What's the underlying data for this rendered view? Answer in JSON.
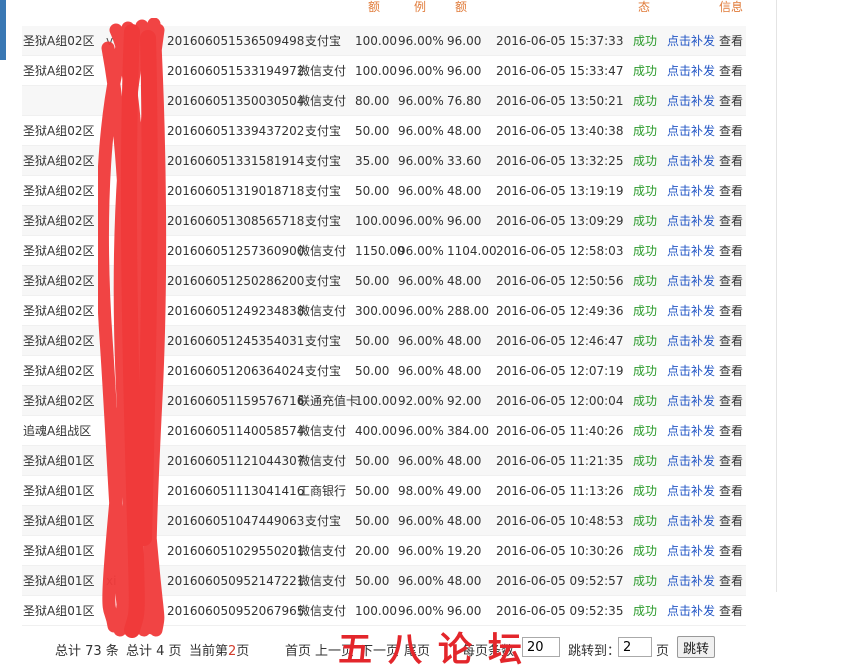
{
  "header": {
    "col_amount": "额",
    "col_rate": "例",
    "col_real": "额",
    "col_state": "态",
    "col_info": "信息"
  },
  "rows": [
    {
      "area": "圣狱A组02区",
      "user": "v",
      "order": "201606051536509498",
      "pay": "支付宝",
      "amount": "100.00",
      "rate": "96.00%",
      "real": "96.00",
      "time": "2016-06-05 15:37:33",
      "state": "成功",
      "resend": "点击补发",
      "view": "查看"
    },
    {
      "area": "圣狱A组02区",
      "user": "",
      "order": "201606051533194972",
      "pay": "微信支付",
      "amount": "100.00",
      "rate": "96.00%",
      "real": "96.00",
      "time": "2016-06-05 15:33:47",
      "state": "成功",
      "resend": "点击补发",
      "view": "查看"
    },
    {
      "area": "",
      "user": "",
      "order": "201606051350030504",
      "pay": "微信支付",
      "amount": "80.00",
      "rate": "96.00%",
      "real": "76.80",
      "time": "2016-06-05 13:50:21",
      "state": "成功",
      "resend": "点击补发",
      "view": "查看"
    },
    {
      "area": "圣狱A组02区",
      "user": "",
      "order": "201606051339437202",
      "pay": "支付宝",
      "amount": "50.00",
      "rate": "96.00%",
      "real": "48.00",
      "time": "2016-06-05 13:40:38",
      "state": "成功",
      "resend": "点击补发",
      "view": "查看"
    },
    {
      "area": "圣狱A组02区",
      "user": "",
      "order": "201606051331581914",
      "pay": "支付宝",
      "amount": "35.00",
      "rate": "96.00%",
      "real": "33.60",
      "time": "2016-06-05 13:32:25",
      "state": "成功",
      "resend": "点击补发",
      "view": "查看"
    },
    {
      "area": "圣狱A组02区",
      "user": "",
      "order": "201606051319018718",
      "pay": "支付宝",
      "amount": "50.00",
      "rate": "96.00%",
      "real": "48.00",
      "time": "2016-06-05 13:19:19",
      "state": "成功",
      "resend": "点击补发",
      "view": "查看"
    },
    {
      "area": "圣狱A组02区",
      "user": "",
      "order": "201606051308565718",
      "pay": "支付宝",
      "amount": "100.00",
      "rate": "96.00%",
      "real": "96.00",
      "time": "2016-06-05 13:09:29",
      "state": "成功",
      "resend": "点击补发",
      "view": "查看"
    },
    {
      "area": "圣狱A组02区",
      "user": "",
      "order": "201606051257360900",
      "pay": "微信支付",
      "amount": "1150.00",
      "rate": "96.00%",
      "real": "1104.00",
      "time": "2016-06-05 12:58:03",
      "state": "成功",
      "resend": "点击补发",
      "view": "查看"
    },
    {
      "area": "圣狱A组02区",
      "user": "",
      "order": "201606051250286200",
      "pay": "支付宝",
      "amount": "50.00",
      "rate": "96.00%",
      "real": "48.00",
      "time": "2016-06-05 12:50:56",
      "state": "成功",
      "resend": "点击补发",
      "view": "查看"
    },
    {
      "area": "圣狱A组02区",
      "user": "",
      "order": "201606051249234838",
      "pay": "微信支付",
      "amount": "300.00",
      "rate": "96.00%",
      "real": "288.00",
      "time": "2016-06-05 12:49:36",
      "state": "成功",
      "resend": "点击补发",
      "view": "查看"
    },
    {
      "area": "圣狱A组02区",
      "user": "",
      "order": "201606051245354031",
      "pay": "支付宝",
      "amount": "50.00",
      "rate": "96.00%",
      "real": "48.00",
      "time": "2016-06-05 12:46:47",
      "state": "成功",
      "resend": "点击补发",
      "view": "查看"
    },
    {
      "area": "圣狱A组02区",
      "user": "",
      "order": "201606051206364024",
      "pay": "支付宝",
      "amount": "50.00",
      "rate": "96.00%",
      "real": "48.00",
      "time": "2016-06-05 12:07:19",
      "state": "成功",
      "resend": "点击补发",
      "view": "查看"
    },
    {
      "area": "圣狱A组02区",
      "user": "",
      "order": "201606051159576716",
      "pay": "联通充值卡",
      "amount": "100.00",
      "rate": "92.00%",
      "real": "92.00",
      "time": "2016-06-05 12:00:04",
      "state": "成功",
      "resend": "点击补发",
      "view": "查看"
    },
    {
      "area": "追魂A组战区",
      "user": "",
      "order": "201606051140058574",
      "pay": "微信支付",
      "amount": "400.00",
      "rate": "96.00%",
      "real": "384.00",
      "time": "2016-06-05 11:40:26",
      "state": "成功",
      "resend": "点击补发",
      "view": "查看"
    },
    {
      "area": "圣狱A组01区",
      "user": "",
      "order": "201606051121044307",
      "pay": "微信支付",
      "amount": "50.00",
      "rate": "96.00%",
      "real": "48.00",
      "time": "2016-06-05 11:21:35",
      "state": "成功",
      "resend": "点击补发",
      "view": "查看"
    },
    {
      "area": "圣狱A组01区",
      "user": "",
      "order": "201606051113041416",
      "pay": "工商银行",
      "amount": "50.00",
      "rate": "98.00%",
      "real": "49.00",
      "time": "2016-06-05 11:13:26",
      "state": "成功",
      "resend": "点击补发",
      "view": "查看"
    },
    {
      "area": "圣狱A组01区",
      "user": "",
      "order": "201606051047449063",
      "pay": "支付宝",
      "amount": "50.00",
      "rate": "96.00%",
      "real": "48.00",
      "time": "2016-06-05 10:48:53",
      "state": "成功",
      "resend": "点击补发",
      "view": "查看"
    },
    {
      "area": "圣狱A组01区",
      "user": "",
      "order": "201606051029550201",
      "pay": "微信支付",
      "amount": "20.00",
      "rate": "96.00%",
      "real": "19.20",
      "time": "2016-06-05 10:30:26",
      "state": "成功",
      "resend": "点击补发",
      "view": "查看"
    },
    {
      "area": "圣狱A组01区",
      "user": "xi",
      "order": "201606050952147221",
      "pay": "微信支付",
      "amount": "50.00",
      "rate": "96.00%",
      "real": "48.00",
      "time": "2016-06-05 09:52:57",
      "state": "成功",
      "resend": "点击补发",
      "view": "查看"
    },
    {
      "area": "圣狱A组01区",
      "user": "",
      "order": "201606050952067965",
      "pay": "微信支付",
      "amount": "100.00",
      "rate": "96.00%",
      "real": "96.00",
      "time": "2016-06-05 09:52:35",
      "state": "成功",
      "resend": "点击补发",
      "view": "查看"
    }
  ],
  "pager": {
    "total_records": "总计 73 条",
    "total_pages": "总计 4 页",
    "current_prefix": "当前第",
    "current_page": "2",
    "current_suffix": "页",
    "first": "首页",
    "prev": "上一页",
    "next": "下一页",
    "last": "尾页",
    "per_page_label": "每页条数",
    "per_page_value": "20",
    "jump_label": "跳转到：",
    "jump_value": "2",
    "page_unit": "页",
    "jump_button": "跳转"
  },
  "watermark": "五八论坛",
  "colors": {
    "success": "#2a9a2a",
    "link": "#2155c5",
    "header": "#e07b3a",
    "scribble": "#f03a3a",
    "watermark": "#e3262b"
  }
}
